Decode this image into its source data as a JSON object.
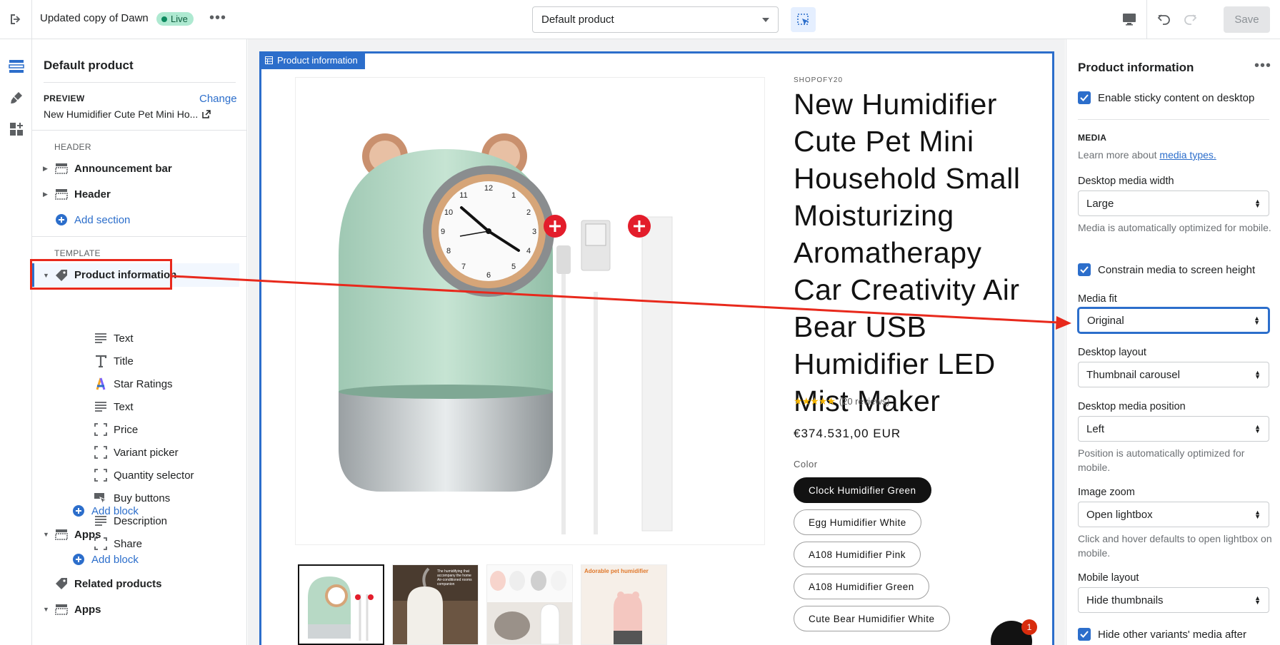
{
  "topbar": {
    "theme_name": "Updated copy of Dawn",
    "status_badge": "Live",
    "page_selector": "Default product",
    "save_label": "Save"
  },
  "sidebar": {
    "title": "Default product",
    "preview_label": "PREVIEW",
    "change_label": "Change",
    "preview_value": "New Humidifier Cute Pet Mini Ho...",
    "header_group": "HEADER",
    "header_items": [
      {
        "label": "Announcement bar"
      },
      {
        "label": "Header"
      }
    ],
    "add_section": "Add section",
    "template_group": "TEMPLATE",
    "product_information": "Product information",
    "blocks": [
      {
        "label": "Text",
        "icon": "text-icon"
      },
      {
        "label": "Title",
        "icon": "title-icon"
      },
      {
        "label": "Star Ratings",
        "icon": "star-ratings-app-icon"
      },
      {
        "label": "Text",
        "icon": "text-icon"
      },
      {
        "label": "Price",
        "icon": "block-frame-icon"
      },
      {
        "label": "Variant picker",
        "icon": "block-frame-icon"
      },
      {
        "label": "Quantity selector",
        "icon": "block-frame-icon"
      },
      {
        "label": "Buy buttons",
        "icon": "buy-buttons-icon"
      },
      {
        "label": "Description",
        "icon": "text-icon"
      },
      {
        "label": "Share",
        "icon": "block-frame-icon"
      }
    ],
    "add_block": "Add block",
    "apps_1": "Apps",
    "add_block_2": "Add block",
    "related_products": "Related products",
    "apps_2": "Apps"
  },
  "preview": {
    "frame_tag": "Product information",
    "vendor": "SHOPOFY20",
    "title": "New Humidifier Cute Pet Mini Household Small Moisturizing Aromatherapy Car Creativity Air Bear USB Humidifier LED Mist Maker",
    "stars": "★★★★★",
    "reviews": "(20 reviews)",
    "price": "€374.531,00 EUR",
    "color_label": "Color",
    "variants": [
      {
        "label": "Clock Humidifier Green",
        "selected": true
      },
      {
        "label": "Egg Humidifier White",
        "selected": false
      },
      {
        "label": "A108 Humidifier Pink",
        "selected": false
      },
      {
        "label": "A108 Humidifier Green",
        "selected": false
      },
      {
        "label": "Cute Bear Humidifier White",
        "selected": false
      }
    ],
    "thumb2_caption": "The humidifying that accompany the home Air-conditioned rooms companion",
    "thumb4_caption": "Adorable pet humidifier",
    "chat_badge": "1"
  },
  "settings": {
    "title": "Product information",
    "sticky": "Enable sticky content on desktop",
    "media_head": "MEDIA",
    "learn_prefix": "Learn more about ",
    "learn_link": "media types.",
    "desktop_media_width_label": "Desktop media width",
    "desktop_media_width": "Large",
    "media_optimized_note": "Media is automatically optimized for mobile.",
    "constrain": "Constrain media to screen height",
    "media_fit_label": "Media fit",
    "media_fit": "Original",
    "desktop_layout_label": "Desktop layout",
    "desktop_layout": "Thumbnail carousel",
    "desktop_media_position_label": "Desktop media position",
    "desktop_media_position": "Left",
    "position_note": "Position is automatically optimized for mobile.",
    "image_zoom_label": "Image zoom",
    "image_zoom": "Open lightbox",
    "zoom_note": "Click and hover defaults to open lightbox on mobile.",
    "mobile_layout_label": "Mobile layout",
    "mobile_layout": "Hide thumbnails",
    "hide_variants": "Hide other variants' media after"
  },
  "colors": {
    "accent": "#2c6ecb",
    "annotation": "#e8291c",
    "live_badge": "#aee9d1"
  }
}
